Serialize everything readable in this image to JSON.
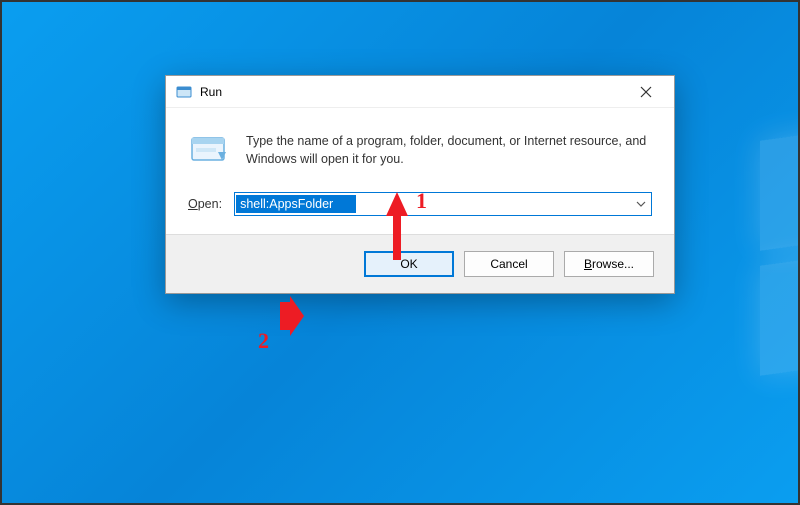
{
  "dialog": {
    "title": "Run",
    "description": "Type the name of a program, folder, document, or Internet resource, and Windows will open it for you.",
    "open_label_prefix": "O",
    "open_label_rest": "pen:",
    "input_value": "shell:AppsFolder",
    "buttons": {
      "ok": "OK",
      "cancel": "Cancel",
      "browse_prefix": "B",
      "browse_rest": "rowse..."
    }
  },
  "annotations": {
    "label1": "1",
    "label2": "2"
  }
}
